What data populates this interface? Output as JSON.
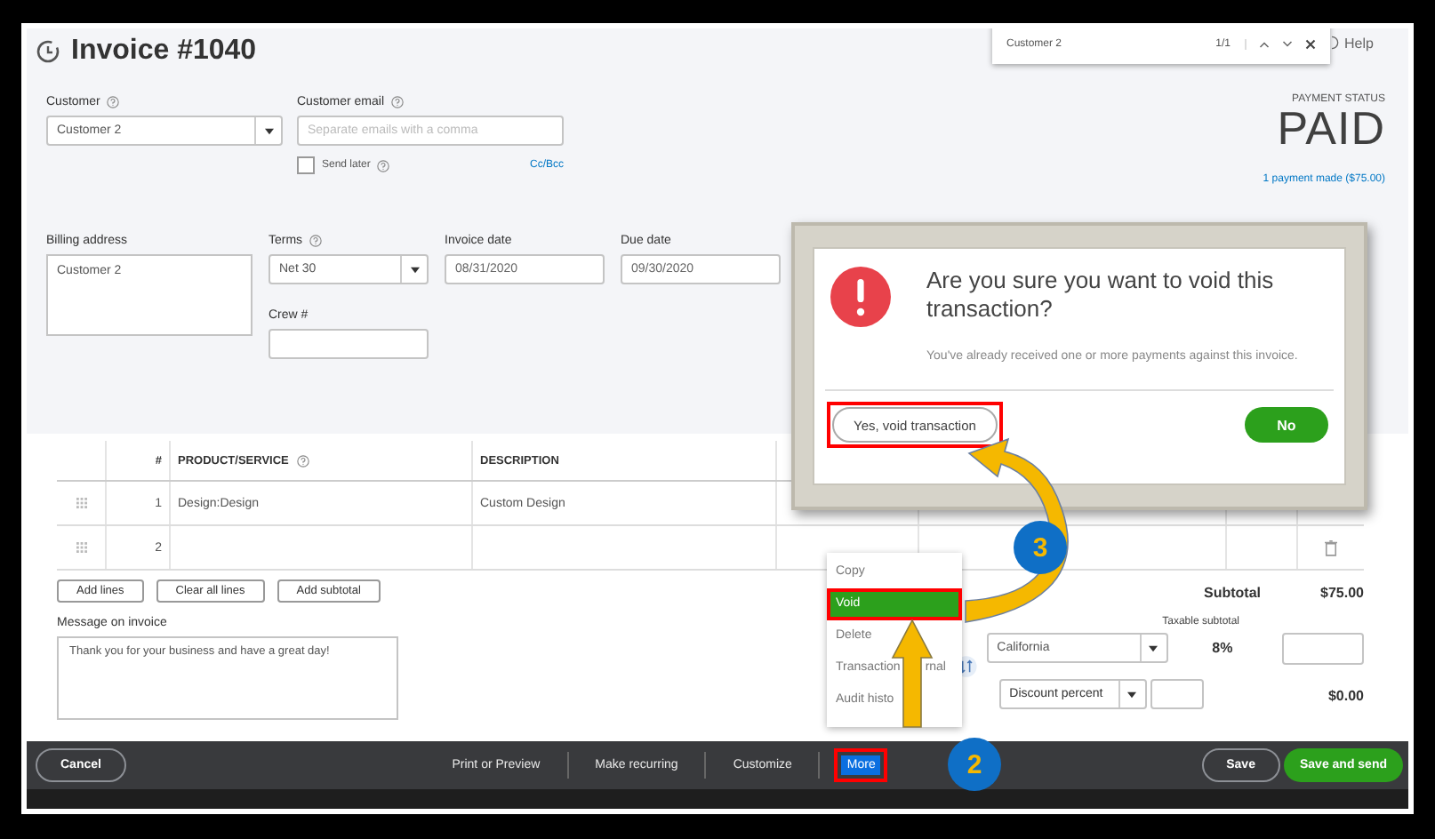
{
  "window": {
    "title": "Invoice #1040"
  },
  "find_bar": {
    "query": "Customer 2",
    "count": "1/1"
  },
  "help": "Help",
  "customer": {
    "label": "Customer",
    "value": "Customer 2"
  },
  "customer_email": {
    "label": "Customer email",
    "placeholder": "Separate emails with a comma",
    "send_later": {
      "label": "Send later",
      "checked": false
    },
    "cc_bcc": "Cc/Bcc"
  },
  "payment_status": {
    "label": "PAYMENT STATUS",
    "value": "PAID",
    "link": "1 payment made ($75.00)"
  },
  "billing_address": {
    "label": "Billing address",
    "value": "Customer 2"
  },
  "terms": {
    "label": "Terms",
    "value": "Net 30"
  },
  "invoice_date": {
    "label": "Invoice date",
    "value": "08/31/2020"
  },
  "due_date": {
    "label": "Due date",
    "value": "09/30/2020"
  },
  "crew": {
    "label": "Crew #"
  },
  "table": {
    "columns": [
      "#",
      "PRODUCT/SERVICE",
      "DESCRIPTION"
    ],
    "rows": [
      {
        "num": "1",
        "product": "Design:Design",
        "description": "Custom Design"
      },
      {
        "num": "2"
      }
    ]
  },
  "line_buttons": [
    "Add lines",
    "Clear all lines",
    "Add subtotal"
  ],
  "message": {
    "label": "Message on invoice",
    "value": "Thank you for your business and have a great day!"
  },
  "totals": {
    "subtotal_label": "Subtotal",
    "subtotal": "$75.00",
    "taxable_label": "Taxable subtotal",
    "tax_region": "California",
    "tax_rate": "8%",
    "discount_type": "Discount percent",
    "discount_total": "$0.00"
  },
  "footer": {
    "cancel": "Cancel",
    "actions": [
      {
        "label": "Print or Preview",
        "selected": false,
        "highlighted": false
      },
      {
        "label": "Make recurring",
        "selected": false,
        "highlighted": false
      },
      {
        "label": "Customize",
        "selected": false,
        "highlighted": false
      },
      {
        "label": "More",
        "selected": true,
        "highlighted": true
      }
    ],
    "save": "Save",
    "save_send": "Save and send"
  },
  "more_menu": [
    {
      "label": "Copy",
      "selected": false,
      "highlighted": false
    },
    {
      "label": "Void",
      "selected": true,
      "highlighted": true
    },
    {
      "label": "Delete",
      "selected": false,
      "highlighted": false
    },
    {
      "label": "Transaction",
      "label_tail": "rnal",
      "selected": false,
      "highlighted": false
    },
    {
      "label": "Audit histo",
      "selected": false,
      "highlighted": false
    }
  ],
  "dialog": {
    "title": "Are you sure you want to void this transaction?",
    "message": "You've already received one or more payments against this invoice.",
    "confirm": "Yes, void transaction",
    "confirm_highlighted": true,
    "cancel": "No"
  },
  "steps": [
    {
      "kind": "step",
      "text": "2"
    },
    {
      "kind": "step",
      "text": "3"
    }
  ]
}
